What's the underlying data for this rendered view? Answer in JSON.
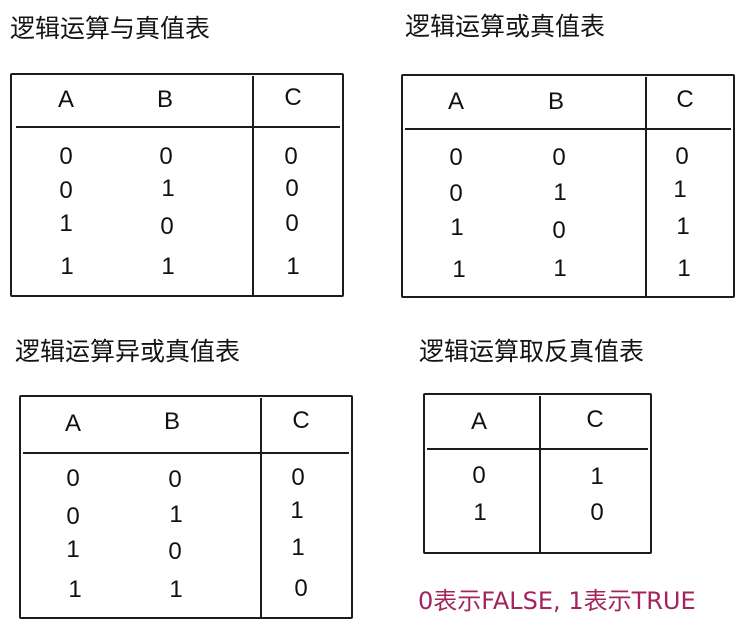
{
  "tables": [
    {
      "title": "逻辑运算与真值表",
      "headers": [
        "A",
        "B",
        "C"
      ],
      "rows": [
        [
          "0",
          "0",
          "0"
        ],
        [
          "0",
          "1",
          "0"
        ],
        [
          "1",
          "0",
          "0"
        ],
        [
          "1",
          "1",
          "1"
        ]
      ]
    },
    {
      "title": "逻辑运算或真值表",
      "headers": [
        "A",
        "B",
        "C"
      ],
      "rows": [
        [
          "0",
          "0",
          "0"
        ],
        [
          "0",
          "1",
          "1"
        ],
        [
          "1",
          "0",
          "1"
        ],
        [
          "1",
          "1",
          "1"
        ]
      ]
    },
    {
      "title": "逻辑运算异或真值表",
      "headers": [
        "A",
        "B",
        "C"
      ],
      "rows": [
        [
          "0",
          "0",
          "0"
        ],
        [
          "0",
          "1",
          "1"
        ],
        [
          "1",
          "0",
          "1"
        ],
        [
          "1",
          "1",
          "0"
        ]
      ]
    },
    {
      "title": "逻辑运算取反真值表",
      "headers": [
        "A",
        "C"
      ],
      "rows": [
        [
          "0",
          "1"
        ],
        [
          "1",
          "0"
        ]
      ]
    }
  ],
  "note": {
    "text": "0表示FALSE, 1表示TRUE",
    "color": "#a3245e"
  }
}
